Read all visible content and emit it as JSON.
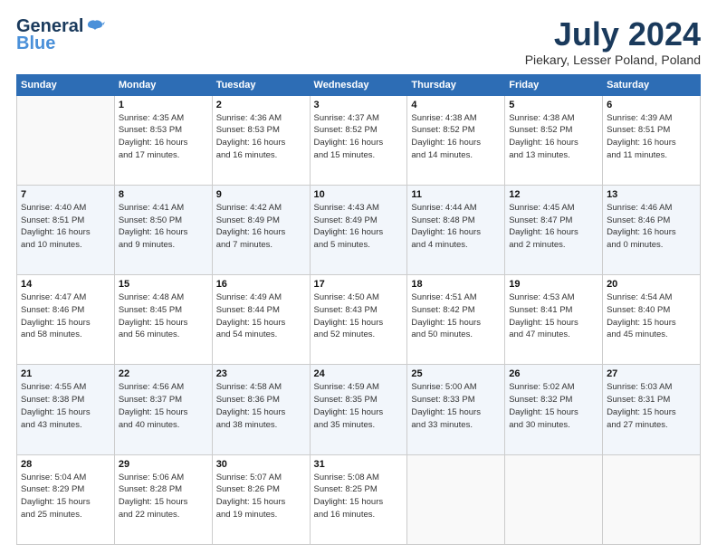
{
  "header": {
    "logo_line1": "General",
    "logo_line2": "Blue",
    "title": "July 2024",
    "subtitle": "Piekary, Lesser Poland, Poland"
  },
  "days_of_week": [
    "Sunday",
    "Monday",
    "Tuesday",
    "Wednesday",
    "Thursday",
    "Friday",
    "Saturday"
  ],
  "weeks": [
    [
      {
        "day": "",
        "sunrise": "",
        "sunset": "",
        "daylight": ""
      },
      {
        "day": "1",
        "sunrise": "Sunrise: 4:35 AM",
        "sunset": "Sunset: 8:53 PM",
        "daylight": "Daylight: 16 hours and 17 minutes."
      },
      {
        "day": "2",
        "sunrise": "Sunrise: 4:36 AM",
        "sunset": "Sunset: 8:53 PM",
        "daylight": "Daylight: 16 hours and 16 minutes."
      },
      {
        "day": "3",
        "sunrise": "Sunrise: 4:37 AM",
        "sunset": "Sunset: 8:52 PM",
        "daylight": "Daylight: 16 hours and 15 minutes."
      },
      {
        "day": "4",
        "sunrise": "Sunrise: 4:38 AM",
        "sunset": "Sunset: 8:52 PM",
        "daylight": "Daylight: 16 hours and 14 minutes."
      },
      {
        "day": "5",
        "sunrise": "Sunrise: 4:38 AM",
        "sunset": "Sunset: 8:52 PM",
        "daylight": "Daylight: 16 hours and 13 minutes."
      },
      {
        "day": "6",
        "sunrise": "Sunrise: 4:39 AM",
        "sunset": "Sunset: 8:51 PM",
        "daylight": "Daylight: 16 hours and 11 minutes."
      }
    ],
    [
      {
        "day": "7",
        "sunrise": "Sunrise: 4:40 AM",
        "sunset": "Sunset: 8:51 PM",
        "daylight": "Daylight: 16 hours and 10 minutes."
      },
      {
        "day": "8",
        "sunrise": "Sunrise: 4:41 AM",
        "sunset": "Sunset: 8:50 PM",
        "daylight": "Daylight: 16 hours and 9 minutes."
      },
      {
        "day": "9",
        "sunrise": "Sunrise: 4:42 AM",
        "sunset": "Sunset: 8:49 PM",
        "daylight": "Daylight: 16 hours and 7 minutes."
      },
      {
        "day": "10",
        "sunrise": "Sunrise: 4:43 AM",
        "sunset": "Sunset: 8:49 PM",
        "daylight": "Daylight: 16 hours and 5 minutes."
      },
      {
        "day": "11",
        "sunrise": "Sunrise: 4:44 AM",
        "sunset": "Sunset: 8:48 PM",
        "daylight": "Daylight: 16 hours and 4 minutes."
      },
      {
        "day": "12",
        "sunrise": "Sunrise: 4:45 AM",
        "sunset": "Sunset: 8:47 PM",
        "daylight": "Daylight: 16 hours and 2 minutes."
      },
      {
        "day": "13",
        "sunrise": "Sunrise: 4:46 AM",
        "sunset": "Sunset: 8:46 PM",
        "daylight": "Daylight: 16 hours and 0 minutes."
      }
    ],
    [
      {
        "day": "14",
        "sunrise": "Sunrise: 4:47 AM",
        "sunset": "Sunset: 8:46 PM",
        "daylight": "Daylight: 15 hours and 58 minutes."
      },
      {
        "day": "15",
        "sunrise": "Sunrise: 4:48 AM",
        "sunset": "Sunset: 8:45 PM",
        "daylight": "Daylight: 15 hours and 56 minutes."
      },
      {
        "day": "16",
        "sunrise": "Sunrise: 4:49 AM",
        "sunset": "Sunset: 8:44 PM",
        "daylight": "Daylight: 15 hours and 54 minutes."
      },
      {
        "day": "17",
        "sunrise": "Sunrise: 4:50 AM",
        "sunset": "Sunset: 8:43 PM",
        "daylight": "Daylight: 15 hours and 52 minutes."
      },
      {
        "day": "18",
        "sunrise": "Sunrise: 4:51 AM",
        "sunset": "Sunset: 8:42 PM",
        "daylight": "Daylight: 15 hours and 50 minutes."
      },
      {
        "day": "19",
        "sunrise": "Sunrise: 4:53 AM",
        "sunset": "Sunset: 8:41 PM",
        "daylight": "Daylight: 15 hours and 47 minutes."
      },
      {
        "day": "20",
        "sunrise": "Sunrise: 4:54 AM",
        "sunset": "Sunset: 8:40 PM",
        "daylight": "Daylight: 15 hours and 45 minutes."
      }
    ],
    [
      {
        "day": "21",
        "sunrise": "Sunrise: 4:55 AM",
        "sunset": "Sunset: 8:38 PM",
        "daylight": "Daylight: 15 hours and 43 minutes."
      },
      {
        "day": "22",
        "sunrise": "Sunrise: 4:56 AM",
        "sunset": "Sunset: 8:37 PM",
        "daylight": "Daylight: 15 hours and 40 minutes."
      },
      {
        "day": "23",
        "sunrise": "Sunrise: 4:58 AM",
        "sunset": "Sunset: 8:36 PM",
        "daylight": "Daylight: 15 hours and 38 minutes."
      },
      {
        "day": "24",
        "sunrise": "Sunrise: 4:59 AM",
        "sunset": "Sunset: 8:35 PM",
        "daylight": "Daylight: 15 hours and 35 minutes."
      },
      {
        "day": "25",
        "sunrise": "Sunrise: 5:00 AM",
        "sunset": "Sunset: 8:33 PM",
        "daylight": "Daylight: 15 hours and 33 minutes."
      },
      {
        "day": "26",
        "sunrise": "Sunrise: 5:02 AM",
        "sunset": "Sunset: 8:32 PM",
        "daylight": "Daylight: 15 hours and 30 minutes."
      },
      {
        "day": "27",
        "sunrise": "Sunrise: 5:03 AM",
        "sunset": "Sunset: 8:31 PM",
        "daylight": "Daylight: 15 hours and 27 minutes."
      }
    ],
    [
      {
        "day": "28",
        "sunrise": "Sunrise: 5:04 AM",
        "sunset": "Sunset: 8:29 PM",
        "daylight": "Daylight: 15 hours and 25 minutes."
      },
      {
        "day": "29",
        "sunrise": "Sunrise: 5:06 AM",
        "sunset": "Sunset: 8:28 PM",
        "daylight": "Daylight: 15 hours and 22 minutes."
      },
      {
        "day": "30",
        "sunrise": "Sunrise: 5:07 AM",
        "sunset": "Sunset: 8:26 PM",
        "daylight": "Daylight: 15 hours and 19 minutes."
      },
      {
        "day": "31",
        "sunrise": "Sunrise: 5:08 AM",
        "sunset": "Sunset: 8:25 PM",
        "daylight": "Daylight: 15 hours and 16 minutes."
      },
      {
        "day": "",
        "sunrise": "",
        "sunset": "",
        "daylight": ""
      },
      {
        "day": "",
        "sunrise": "",
        "sunset": "",
        "daylight": ""
      },
      {
        "day": "",
        "sunrise": "",
        "sunset": "",
        "daylight": ""
      }
    ]
  ]
}
